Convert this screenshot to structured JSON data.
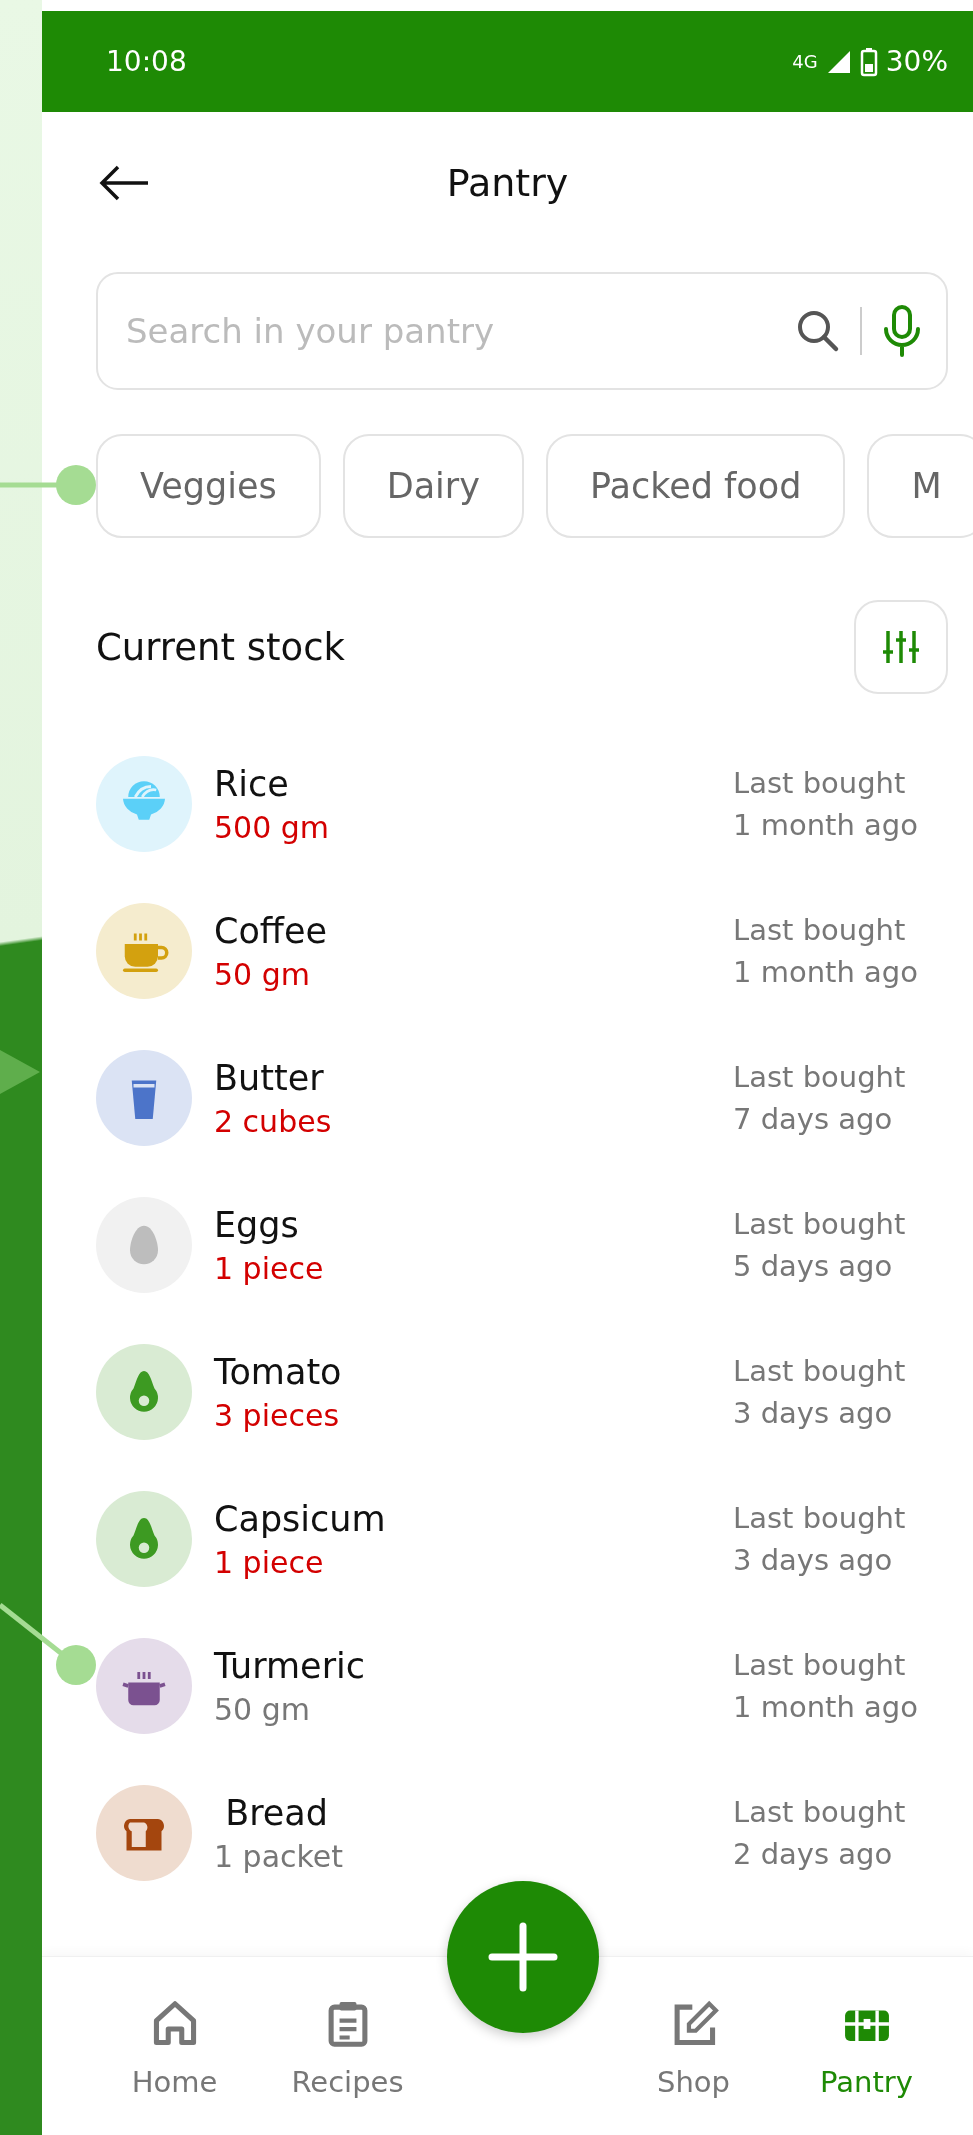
{
  "status_bar": {
    "time": "10:08",
    "network": "4G",
    "battery": "30%"
  },
  "header": {
    "title": "Pantry"
  },
  "search": {
    "placeholder": "Search in your pantry"
  },
  "chips": [
    {
      "label": "Veggies"
    },
    {
      "label": "Dairy"
    },
    {
      "label": "Packed food"
    },
    {
      "label": "M"
    }
  ],
  "section": {
    "title": "Current stock"
  },
  "items": [
    {
      "name": "Rice",
      "quantity": "500 gm",
      "low": true,
      "kind": "bowl",
      "last_label": "Last bought",
      "last_time": "1 month ago"
    },
    {
      "name": "Coffee",
      "quantity": "50 gm",
      "low": true,
      "kind": "cup",
      "last_label": "Last bought",
      "last_time": "1 month ago"
    },
    {
      "name": "Butter",
      "quantity": "2 cubes",
      "low": true,
      "kind": "glass",
      "last_label": "Last bought",
      "last_time": "7 days ago"
    },
    {
      "name": "Eggs",
      "quantity": "1 piece",
      "low": true,
      "kind": "egg",
      "last_label": "Last bought",
      "last_time": "5 days ago"
    },
    {
      "name": "Tomato",
      "quantity": "3 pieces",
      "low": true,
      "kind": "avocado",
      "last_label": "Last bought",
      "last_time": "3 days ago"
    },
    {
      "name": "Capsicum",
      "quantity": "1 piece",
      "low": true,
      "kind": "avocado",
      "last_label": "Last bought",
      "last_time": "3 days ago"
    },
    {
      "name": "Turmeric",
      "quantity": "50 gm",
      "low": false,
      "kind": "pot",
      "last_label": "Last bought",
      "last_time": "1 month ago"
    },
    {
      "name": " Bread",
      "quantity": "1 packet",
      "low": false,
      "kind": "bread",
      "last_label": "Last bought",
      "last_time": "2 days ago"
    }
  ],
  "nav": [
    {
      "label": "Home",
      "kind": "home",
      "selected": false
    },
    {
      "label": "Recipes",
      "kind": "clipboard",
      "selected": false
    },
    {
      "label": "Shop",
      "kind": "edit",
      "selected": false
    },
    {
      "label": "Pantry",
      "kind": "chest",
      "selected": true
    }
  ]
}
